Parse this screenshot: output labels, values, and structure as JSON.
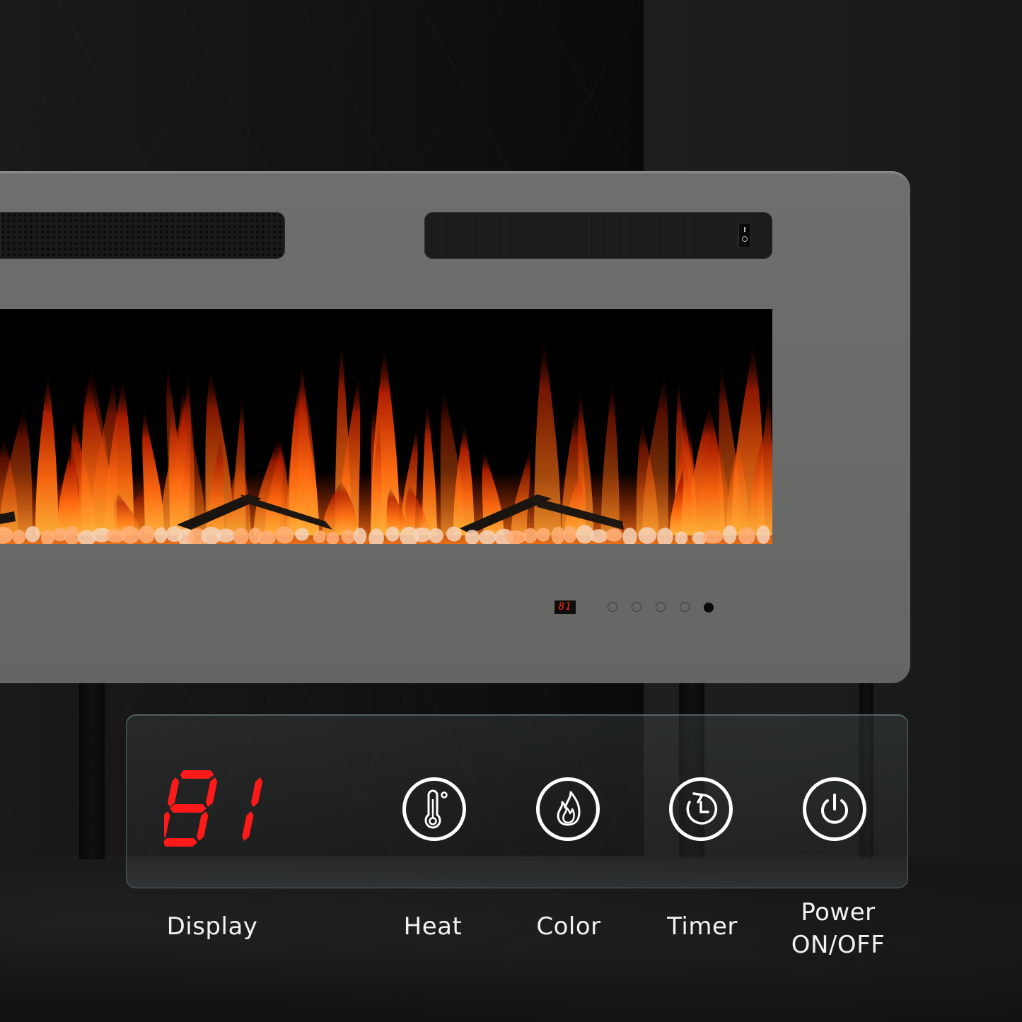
{
  "product": "Electric fireplace control panel",
  "fireplace": {
    "frame_color": "#6b6c6a",
    "rocker_switch": {
      "on_symbol": "I",
      "off_symbol": "O"
    },
    "mini_display_value": "81"
  },
  "control_panel": {
    "display_value": "81",
    "display_color": "#ff1a1a",
    "controls": [
      {
        "id": "display",
        "label": "Display",
        "icon": "seven-segment-display"
      },
      {
        "id": "heat",
        "label": "Heat",
        "icon": "thermometer-icon"
      },
      {
        "id": "color",
        "label": "Color",
        "icon": "flame-icon"
      },
      {
        "id": "timer",
        "label": "Timer",
        "icon": "timer-clock-icon"
      },
      {
        "id": "power",
        "label_line1": "Power",
        "label_line2": "ON/OFF",
        "icon": "power-icon"
      }
    ]
  }
}
